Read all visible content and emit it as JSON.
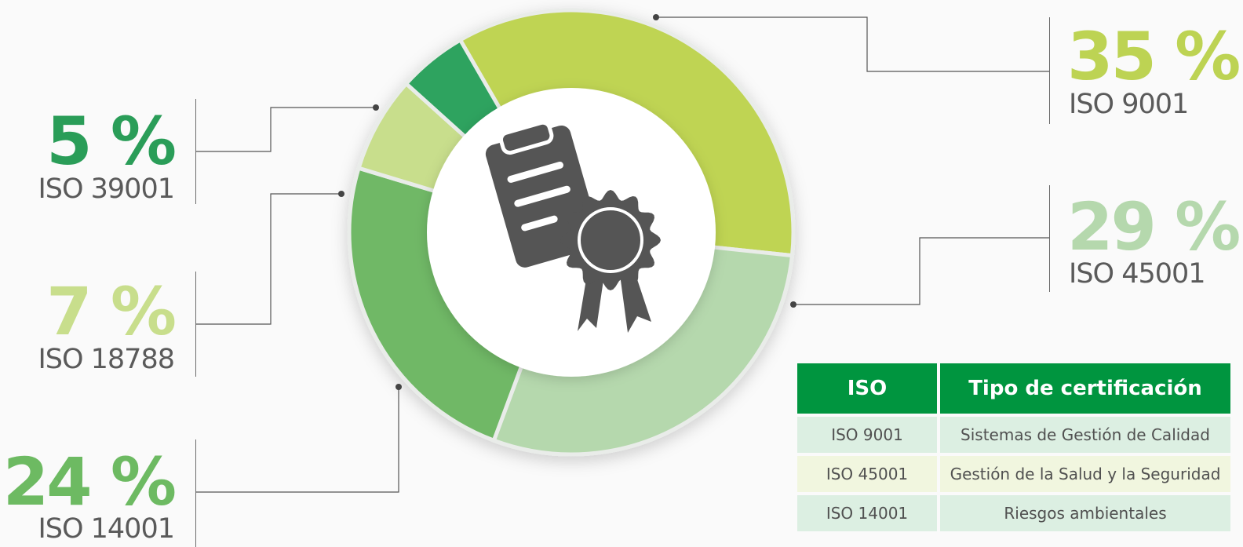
{
  "chart_data": {
    "type": "pie",
    "categories": [
      "ISO 9001",
      "ISO 45001",
      "ISO 14001",
      "ISO 18788",
      "ISO 39001"
    ],
    "values": [
      35,
      29,
      24,
      7,
      5
    ],
    "value_labels": [
      "35 %",
      "29 %",
      "24 %",
      "7 %",
      "5 %"
    ],
    "colors": [
      "#bfd452",
      "#b5d8ad",
      "#70b866",
      "#c8de8c",
      "#2ea35f"
    ],
    "label_colors": [
      "#bdd353",
      "#b5d8ad",
      "#6dba62",
      "#c8de8c",
      "#2a9d58"
    ],
    "style": "donut",
    "center_icon": "certificate-icon",
    "legend_position": "callouts"
  },
  "table": {
    "headers": [
      "ISO",
      "Tipo de certificación"
    ],
    "rows": [
      [
        "ISO 9001",
        "Sistemas de Gestión de Calidad"
      ],
      [
        "ISO 45001",
        "Gestión de la Salud y la Seguridad"
      ],
      [
        "ISO 14001",
        "Riesgos ambientales"
      ]
    ],
    "header_color": "#00953f"
  }
}
